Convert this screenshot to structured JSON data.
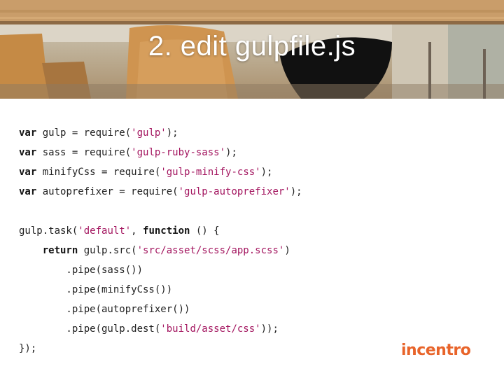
{
  "slide": {
    "title": "2. edit gulpfile.js"
  },
  "code": {
    "lines": [
      [
        {
          "t": "var",
          "c": "kw"
        },
        {
          "t": " gulp = require("
        },
        {
          "t": "'gulp'",
          "c": "str"
        },
        {
          "t": ");"
        }
      ],
      [
        {
          "t": "var",
          "c": "kw"
        },
        {
          "t": " sass = require("
        },
        {
          "t": "'gulp-ruby-sass'",
          "c": "str"
        },
        {
          "t": ");"
        }
      ],
      [
        {
          "t": "var",
          "c": "kw"
        },
        {
          "t": " minifyCss = require("
        },
        {
          "t": "'gulp-minify-css'",
          "c": "str"
        },
        {
          "t": ");"
        }
      ],
      [
        {
          "t": "var",
          "c": "kw"
        },
        {
          "t": " autoprefixer = require("
        },
        {
          "t": "'gulp-autoprefixer'",
          "c": "str"
        },
        {
          "t": ");"
        }
      ],
      [],
      [
        {
          "t": "gulp.task("
        },
        {
          "t": "'default'",
          "c": "str"
        },
        {
          "t": ", "
        },
        {
          "t": "function",
          "c": "kw"
        },
        {
          "t": " () {"
        }
      ],
      [
        {
          "t": "    "
        },
        {
          "t": "return",
          "c": "kw"
        },
        {
          "t": " gulp.src("
        },
        {
          "t": "'src/asset/scss/app.scss'",
          "c": "str"
        },
        {
          "t": ")"
        }
      ],
      [
        {
          "t": "        .pipe(sass())"
        }
      ],
      [
        {
          "t": "        .pipe(minifyCss())"
        }
      ],
      [
        {
          "t": "        .pipe(autoprefixer())"
        }
      ],
      [
        {
          "t": "        .pipe(gulp.dest("
        },
        {
          "t": "'build/asset/css'",
          "c": "str"
        },
        {
          "t": "));"
        }
      ],
      [
        {
          "t": "});"
        }
      ]
    ]
  },
  "logo": {
    "text": "incentro",
    "color": "#e8642a"
  },
  "colors": {
    "string": "#a3155f",
    "keyword": "#111111",
    "text": "#222222"
  }
}
